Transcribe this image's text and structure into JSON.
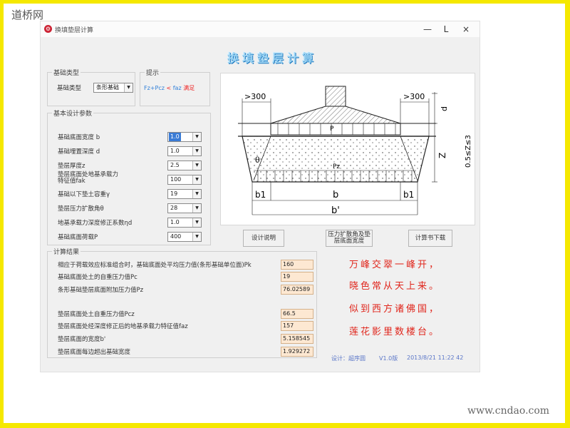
{
  "watermarks": {
    "top": "道桥网",
    "bottom": "www.cndao.com"
  },
  "window": {
    "title": "换填垫层计算",
    "controls": {
      "minimize": "—",
      "maximize": "L",
      "close": "×"
    }
  },
  "main_title": "换填垫层计算",
  "foundation_type": {
    "group_label": "基础类型",
    "field_label": "基础类型",
    "value": "条形基础"
  },
  "hint": {
    "group_label": "提示",
    "lhs": "Fz+Pcz",
    "op": "<",
    "rhs": "faz",
    "result": "满足"
  },
  "design_params": {
    "group_label": "基本设计参数",
    "fields": [
      {
        "label": "基础底面宽度 b",
        "value": "1.0"
      },
      {
        "label": "基础埋置深度 d",
        "value": "1.0"
      },
      {
        "label": "垫层厚度z",
        "value": "2.5"
      },
      {
        "label": "垫层底面处地基承载力特征值fak",
        "value": "100"
      },
      {
        "label": "基础以下垫土容重γ",
        "value": "19"
      },
      {
        "label": "垫层压力扩散角θ",
        "value": "28"
      },
      {
        "label": "地基承载力深度修正系数ηd",
        "value": "1.0"
      },
      {
        "label": "基础底面荷载P",
        "value": "400"
      }
    ]
  },
  "results": {
    "group_label": "计算结果",
    "rows": [
      {
        "label": "相应于荷载效应标准组合时，基础底面处平均压力值(条形基础单位面)Pk",
        "value": "160"
      },
      {
        "label": "基础底面处土的自重压力值Pc",
        "value": "19"
      },
      {
        "label": "条形基础垫层底面附加压力值Pz",
        "value": "76.02589"
      },
      {
        "label": "垫层底面处土自重压力值Pcz",
        "value": "66.5"
      },
      {
        "label": "垫层底面处经深度修正后的地基承载力特征值faz",
        "value": "157"
      },
      {
        "label": "垫层底面的宽度b'",
        "value": "5.158545"
      },
      {
        "label": "垫层底面每边超出基础宽度",
        "value": "1.929272"
      }
    ]
  },
  "buttons": {
    "design_explain": "设计说明",
    "pressure_angle": "压力扩散角及垫层底面宽度",
    "calc_sheet": "计算书下载"
  },
  "diagram": {
    "labels": {
      "left_dim": ">300",
      "right_dim": ">300",
      "d_label": "d",
      "z_label": "Z",
      "z_range": "0.5≤Z≤3",
      "theta": "θ",
      "p_label": "P",
      "pz_label": "Pz",
      "b1_left": "b1",
      "b": "b",
      "b1_right": "b1",
      "b_prime": "b'"
    }
  },
  "poem": [
    "万峰交翠一峰开，",
    "晓色常从天上来。",
    "似到西方诸佛国，",
    "莲花影里数楼台。"
  ],
  "footer": {
    "designer": "设计：超序圆",
    "version": "V1.0版",
    "datetime": "2013/8/21 11:22 42"
  }
}
